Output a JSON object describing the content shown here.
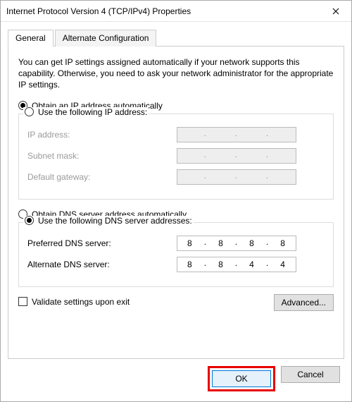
{
  "window": {
    "title": "Internet Protocol Version 4 (TCP/IPv4) Properties"
  },
  "tabs": {
    "general": "General",
    "alternate": "Alternate Configuration"
  },
  "intro": "You can get IP settings assigned automatically if your network supports this capability. Otherwise, you need to ask your network administrator for the appropriate IP settings.",
  "ip_section": {
    "auto_label": "Obtain an IP address automatically",
    "manual_label": "Use the following IP address:",
    "mode": "auto",
    "ip_address_label": "IP address:",
    "subnet_label": "Subnet mask:",
    "gateway_label": "Default gateway:",
    "ip_address": "",
    "subnet_mask": "",
    "default_gateway": ""
  },
  "dns_section": {
    "auto_label": "Obtain DNS server address automatically",
    "manual_label": "Use the following DNS server addresses:",
    "mode": "manual",
    "preferred_label": "Preferred DNS server:",
    "alternate_label": "Alternate DNS server:",
    "preferred_dns": {
      "o1": "8",
      "o2": "8",
      "o3": "8",
      "o4": "8"
    },
    "alternate_dns": {
      "o1": "8",
      "o2": "8",
      "o3": "4",
      "o4": "4"
    }
  },
  "validate_label": "Validate settings upon exit",
  "validate_checked": false,
  "buttons": {
    "advanced": "Advanced...",
    "ok": "OK",
    "cancel": "Cancel"
  }
}
